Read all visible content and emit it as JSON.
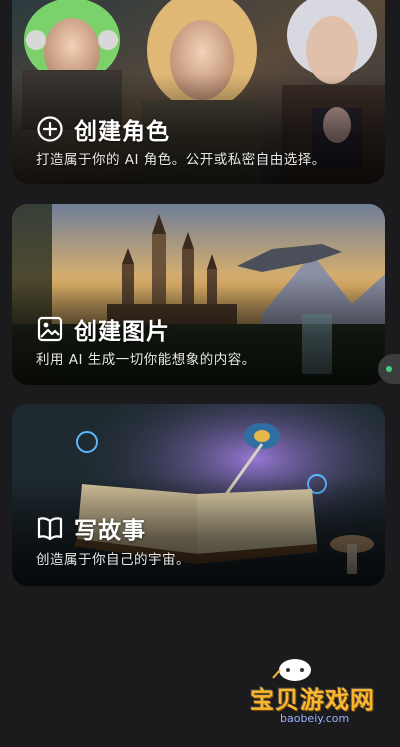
{
  "cards": [
    {
      "id": "create_character",
      "title": "创建角色",
      "description": "打造属于你的 AI 角色。公开或私密自由选择。",
      "icon": "plus-circle-icon"
    },
    {
      "id": "create_image",
      "title": "创建图片",
      "description": "利用 AI 生成一切你能想象的内容。",
      "icon": "image-icon"
    },
    {
      "id": "write_story",
      "title": "写故事",
      "description": "创造属于你自己的宇宙。",
      "icon": "open-book-icon"
    }
  ],
  "watermark": {
    "title": "宝贝游戏网",
    "url": "baobeiy.com"
  },
  "colors": {
    "background": "#1b1b1d",
    "accent": "#3fd27a",
    "watermark": "#f7b733"
  }
}
